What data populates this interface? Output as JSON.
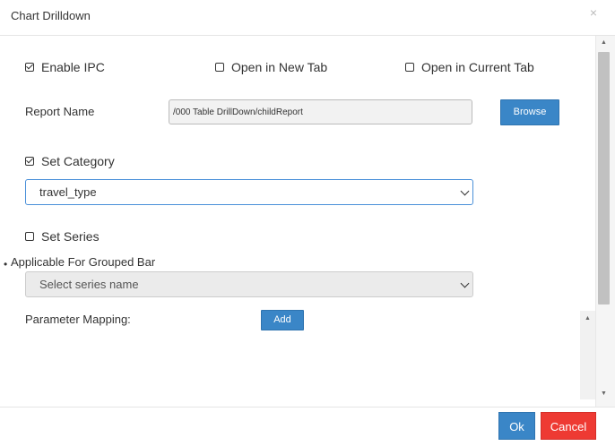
{
  "dialog": {
    "title": "Chart Drilldown",
    "close_glyph": "×"
  },
  "options": {
    "enable_ipc": {
      "label": "Enable IPC",
      "checked": true
    },
    "open_new_tab": {
      "label": "Open in New Tab",
      "checked": false
    },
    "open_current_tab": {
      "label": "Open in Current Tab",
      "checked": false
    }
  },
  "report": {
    "label": "Report Name",
    "value": "/000 Table DrillDown/childReport",
    "browse_label": "Browse"
  },
  "category": {
    "label": "Set Category",
    "checked": true,
    "selected": "travel_type"
  },
  "series": {
    "label": "Set Series",
    "checked": false,
    "bullet": "•",
    "note": "Applicable For Grouped Bar",
    "placeholder": "Select series name"
  },
  "parameter_mapping": {
    "label": "Parameter Mapping:",
    "add_label": "Add"
  },
  "footer": {
    "ok_label": "Ok",
    "cancel_label": "Cancel"
  },
  "scrollbar": {
    "up_glyph": "▲",
    "down_glyph": "▼"
  },
  "colors": {
    "primary": "#3a86c7",
    "danger": "#ee3a33",
    "select_focus_border": "#4a90d9"
  }
}
